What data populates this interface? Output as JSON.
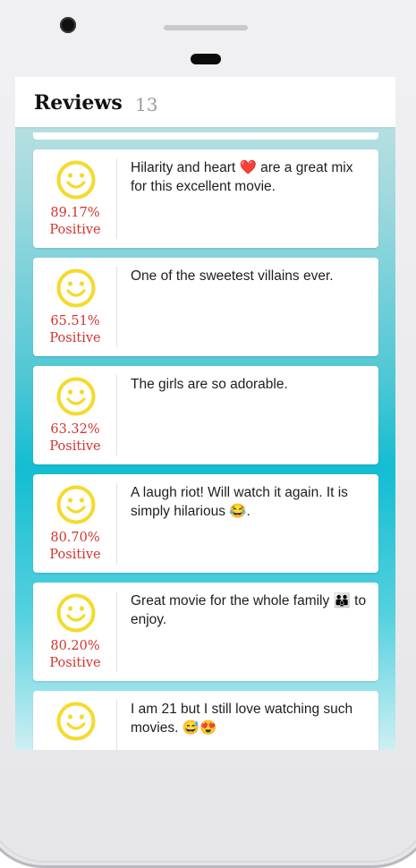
{
  "header": {
    "title": "Reviews",
    "count": "13"
  },
  "reviews": [
    {
      "score": "89.17%",
      "label": "Positive",
      "text": "Hilarity and heart ❤️ are a great mix for this excellent movie."
    },
    {
      "score": "65.51%",
      "label": "Positive",
      "text": "One of the sweetest villains ever."
    },
    {
      "score": "63.32%",
      "label": "Positive",
      "text": "The girls are so adorable."
    },
    {
      "score": "80.70%",
      "label": "Positive",
      "text": "A laugh riot! Will watch it again. It is simply hilarious 😂."
    },
    {
      "score": "80.20%",
      "label": "Positive",
      "text": "Great movie for the whole family 👪 to enjoy."
    },
    {
      "score": "",
      "label": "",
      "text": "I am 21 but I still love watching such movies. 😅😍"
    }
  ],
  "colors": {
    "score": "#d3342e",
    "smiley": "#f5da2b"
  },
  "icons": {
    "sentiment": "smiley-icon"
  }
}
